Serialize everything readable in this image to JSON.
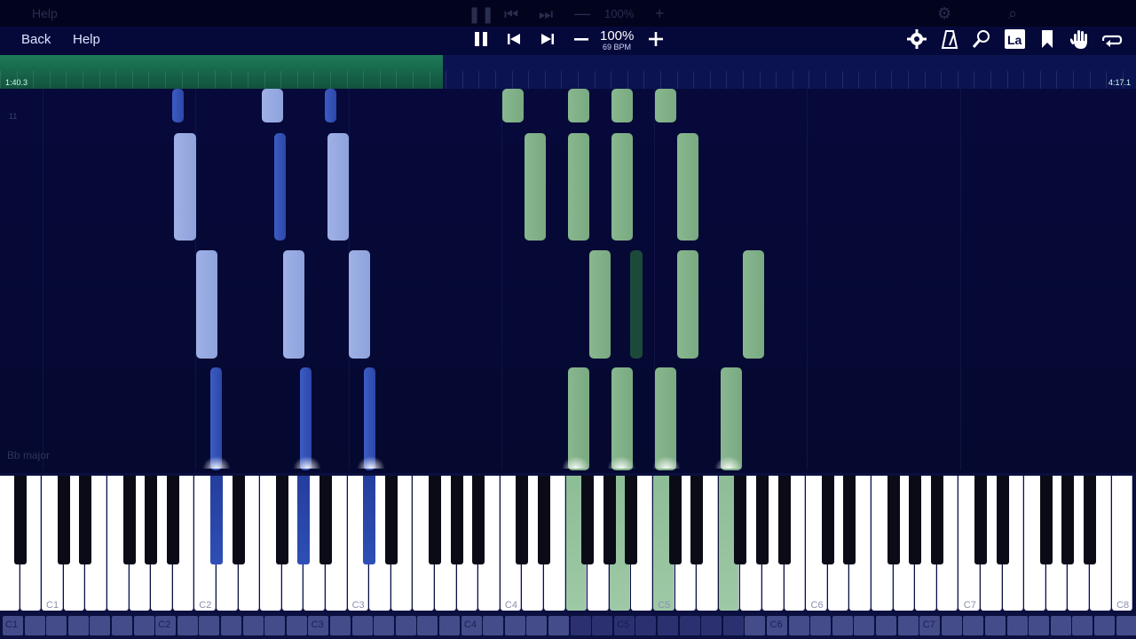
{
  "ghost_header": {
    "title": "Help",
    "zoom": "100%"
  },
  "nav": {
    "back": "Back",
    "help": "Help"
  },
  "transport": {
    "zoom": "100%",
    "bpm": "69 BPM"
  },
  "progress": {
    "elapsed": "1:40.3",
    "total": "4:17.1",
    "fraction": 0.39,
    "marker": "11"
  },
  "key_signature": "Bb major",
  "keyboard": {
    "octave_labels": [
      "C1",
      "C2",
      "C3",
      "C4",
      "C5",
      "C6",
      "C7",
      "C8"
    ],
    "mini_labels": [
      "C1",
      "C2",
      "C3",
      "C4",
      "C5",
      "C6",
      "C7"
    ]
  },
  "colors": {
    "left_hand": "#93a6de",
    "right_hand": "#85b48c",
    "background": "#050930",
    "progress": "#1d7a58"
  },
  "icons": [
    "pause-icon",
    "previous-icon",
    "next-icon",
    "minus-icon",
    "plus-icon",
    "settings-gear-icon",
    "metronome-icon",
    "search-icon",
    "note-labels-icon",
    "bookmark-icon",
    "hand-icon",
    "loop-icon"
  ]
}
